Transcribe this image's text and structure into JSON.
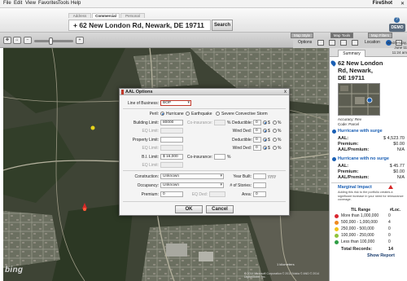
{
  "menu": [
    "File",
    "Edit",
    "View",
    "Favorites",
    "Tools",
    "Help"
  ],
  "brand": "FireShot",
  "address_tabs": [
    "Address",
    "Commercial",
    "Personal"
  ],
  "address": "62 New London Rd, Newark, DE 19711",
  "search_label": "Search",
  "demo_label": "DEMO",
  "toolbar_tabs": [
    "Map Style",
    "Map Tools",
    "Map Filters"
  ],
  "toolbar_labels": {
    "options": "Options",
    "location": "Location"
  },
  "datetime": {
    "day": "Wednesday, June 11",
    "time": "11:24 am"
  },
  "map": {
    "brand": "bing",
    "copyright": "© 2014 Microsoft Corporation  © 2013 Nokia  © AND  © 2014 DigitalGlobe, Inc.",
    "scale": "1 kilometers"
  },
  "dialog": {
    "title": "AAL Options",
    "close": "x",
    "line_of_business_label": "Line of Business:",
    "line_of_business": "BOP",
    "peril_label": "Peril:",
    "perils": [
      "Hurricane",
      "Earthquake",
      "Severe Convective Storm"
    ],
    "building_limit_label": "Building Limit:",
    "building_limit": "80000",
    "coinsurance_label": "Co-insurance:",
    "coinsurance_building": "%",
    "deductible_label": "Deductible:",
    "deductible_building": "0",
    "eq_limit_label": "EQ Limit:",
    "wind_ded_label": "Wind Ded:",
    "wind_ded_1": "0",
    "property_limit_label": "Property Limit:",
    "deductible_property": "0",
    "wind_ded_2": "0",
    "bi_limit_label": "B.I. Limit:",
    "bi_limit": "$ 16,000",
    "coinsurance_bi": "%",
    "construction_label": "Construction:",
    "construction": "Unknown",
    "year_built_label": "Year Built:",
    "year_built_unit": "yyyy",
    "occupancy_label": "Occupancy:",
    "occupancy": "Unknown",
    "stories_label": "# of Stories:",
    "premium_label": "Premium:",
    "premium": "0",
    "eq_ded_label": "EQ Ded:",
    "area_label": "Area:",
    "area": "0",
    "ok_label": "OK",
    "cancel_label": "Cancel"
  },
  "panel": {
    "tab": "Summary",
    "address_line1": "62 New London",
    "address_line2": "Rd, Newark,",
    "address_line3": "DE 19711",
    "accuracy": "Accuracy: Rev",
    "code": "Code: Parcel",
    "hurricane_with_surge": "Hurricane with surge",
    "aal_label": "AAL:",
    "aal_with_surge": "$ 4,523.70",
    "premium_label": "Premium:",
    "premium_with_surge": "$0.00",
    "aal_premium_label": "AAL/Premium:",
    "ratio_with_surge": "N/A",
    "hurricane_no_surge": "Hurricane with no surge",
    "aal_no_surge": "$ 45.77",
    "premium_no_surge": "$0.00",
    "ratio_no_surge": "N/A",
    "marginal_title": "Marginal Impact",
    "marginal_text": "Adding this risk to the portfolio creates a significant increase in your need for reinsurance coverage.",
    "tiv_header": "TIL Range",
    "count_header": "#Loc.",
    "tiv_rows": [
      {
        "label": "More than 1,000,000",
        "count": "0",
        "color": "#d9262f"
      },
      {
        "label": "500,000 - 1,000,000",
        "count": "4",
        "color": "#ef8a1f"
      },
      {
        "label": "250,000 - 500,000",
        "count": "0",
        "color": "#f2c318"
      },
      {
        "label": "100,000 - 250,000",
        "count": "0",
        "color": "#8fc33c"
      },
      {
        "label": "Less than 100,000",
        "count": "0",
        "color": "#2f9e44"
      }
    ],
    "total_label": "Total Records:",
    "total": "14",
    "show_report": "Show Report"
  }
}
